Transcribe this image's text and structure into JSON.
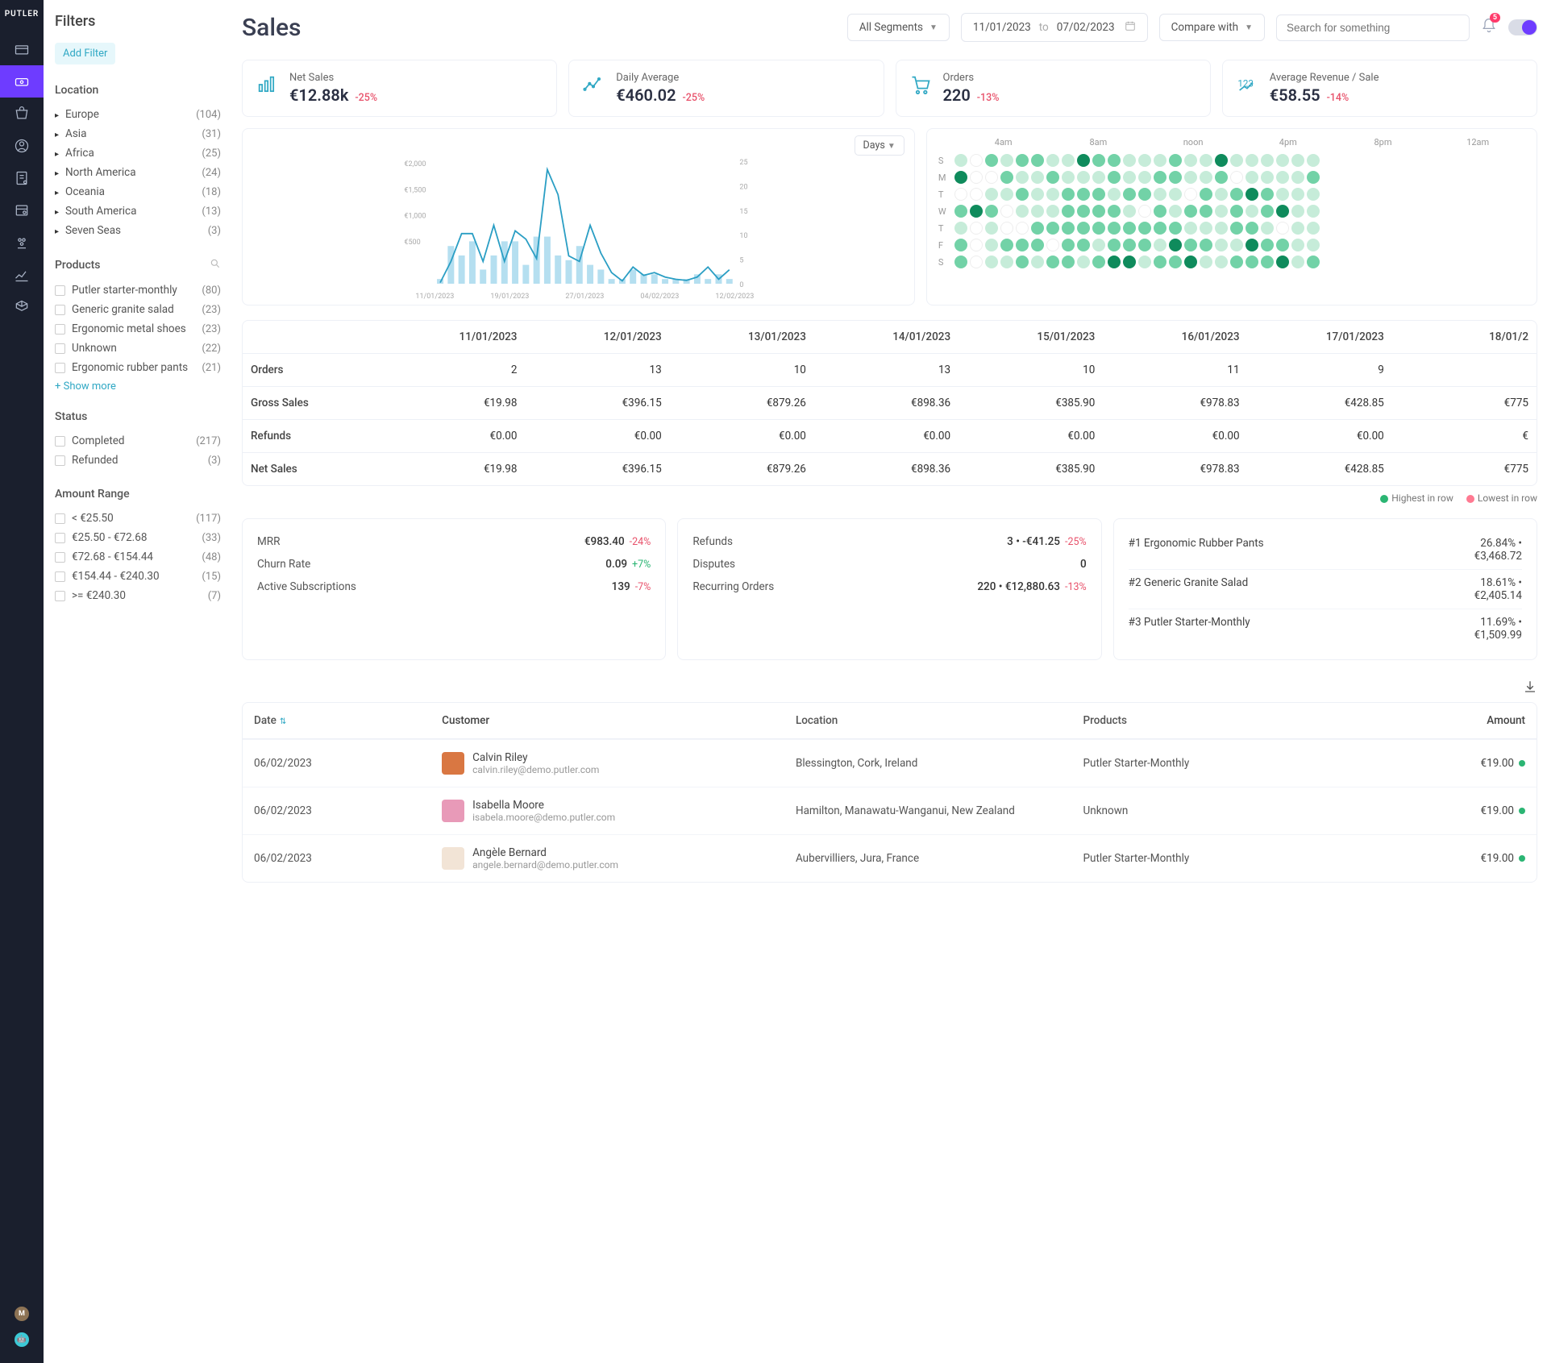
{
  "brand": "PUTLER",
  "pageTitle": "Sales",
  "header": {
    "segments": "All Segments",
    "dateFrom": "11/01/2023",
    "dateTo": "07/02/2023",
    "to": "to",
    "compare": "Compare with",
    "searchPlaceholder": "Search for something",
    "notifCount": "5"
  },
  "filtersHead": "Filters",
  "addFilter": "Add Filter",
  "filterGroups": {
    "location": {
      "title": "Location",
      "items": [
        {
          "label": "Europe",
          "count": "(104)"
        },
        {
          "label": "Asia",
          "count": "(31)"
        },
        {
          "label": "Africa",
          "count": "(25)"
        },
        {
          "label": "North America",
          "count": "(24)"
        },
        {
          "label": "Oceania",
          "count": "(18)"
        },
        {
          "label": "South America",
          "count": "(13)"
        },
        {
          "label": "Seven Seas",
          "count": "(3)"
        }
      ]
    },
    "products": {
      "title": "Products",
      "items": [
        {
          "label": "Putler starter-monthly",
          "count": "(80)"
        },
        {
          "label": "Generic granite salad",
          "count": "(23)"
        },
        {
          "label": "Ergonomic metal shoes",
          "count": "(23)"
        },
        {
          "label": "Unknown",
          "count": "(22)"
        },
        {
          "label": "Ergonomic rubber pants",
          "count": "(21)"
        }
      ],
      "showMore": "+ Show more"
    },
    "status": {
      "title": "Status",
      "items": [
        {
          "label": "Completed",
          "count": "(217)"
        },
        {
          "label": "Refunded",
          "count": "(3)"
        }
      ]
    },
    "amount": {
      "title": "Amount Range",
      "items": [
        {
          "label": "< €25.50",
          "count": "(117)"
        },
        {
          "label": "€25.50 - €72.68",
          "count": "(33)"
        },
        {
          "label": "€72.68 - €154.44",
          "count": "(48)"
        },
        {
          "label": "€154.44 - €240.30",
          "count": "(15)"
        },
        {
          "label": ">= €240.30",
          "count": "(7)"
        }
      ]
    }
  },
  "kpis": [
    {
      "label": "Net Sales",
      "value": "€12.88k",
      "delta": "-25%"
    },
    {
      "label": "Daily Average",
      "value": "€460.02",
      "delta": "-25%"
    },
    {
      "label": "Orders",
      "value": "220",
      "delta": "-13%"
    },
    {
      "label": "Average Revenue / Sale",
      "value": "€58.55",
      "delta": "-14%"
    }
  ],
  "chart_data": {
    "type": "line+bar",
    "daysLabel": "Days",
    "ylabelsLeft": [
      "€2,000",
      "€1,500",
      "€1,000",
      "€500"
    ],
    "ylabelsRight": [
      "25",
      "20",
      "15",
      "10",
      "5",
      "0"
    ],
    "xlabels": [
      "11/01/2023",
      "19/01/2023",
      "27/01/2023",
      "04/02/2023",
      "12/02/2023"
    ],
    "bars": [
      1,
      8,
      6,
      9,
      3,
      6,
      9,
      9,
      4,
      10,
      10,
      6,
      5,
      8,
      4,
      3,
      1,
      1,
      3,
      2,
      2,
      1,
      1,
      1,
      2,
      1,
      2,
      1
    ],
    "line": [
      20,
      400,
      900,
      900,
      400,
      1050,
      400,
      950,
      800,
      450,
      2050,
      1600,
      500,
      400,
      1050,
      550,
      200,
      50,
      300,
      150,
      200,
      120,
      80,
      60,
      120,
      300,
      80,
      250
    ],
    "leftMax": 2200,
    "rightMax": 26
  },
  "heatmap": {
    "head": [
      "4am",
      "8am",
      "noon",
      "4pm",
      "8pm",
      "12am"
    ],
    "days": [
      "S",
      "M",
      "T",
      "W",
      "T",
      "F",
      "S"
    ],
    "grid": [
      [
        1,
        0,
        2,
        1,
        2,
        2,
        1,
        1,
        3,
        2,
        2,
        1,
        1,
        1,
        2,
        1,
        1,
        3,
        1,
        1,
        1,
        1,
        1,
        1
      ],
      [
        3,
        0,
        0,
        2,
        1,
        1,
        2,
        1,
        1,
        1,
        2,
        1,
        1,
        2,
        2,
        1,
        1,
        2,
        0,
        1,
        1,
        1,
        1,
        2
      ],
      [
        0,
        0,
        1,
        1,
        2,
        1,
        1,
        2,
        2,
        2,
        1,
        2,
        2,
        1,
        1,
        0,
        2,
        1,
        2,
        3,
        2,
        1,
        1,
        1
      ],
      [
        2,
        3,
        2,
        0,
        1,
        1,
        1,
        2,
        2,
        2,
        2,
        1,
        0,
        2,
        1,
        2,
        2,
        1,
        2,
        1,
        2,
        3,
        1,
        1
      ],
      [
        1,
        0,
        1,
        0,
        0,
        2,
        2,
        2,
        2,
        2,
        2,
        2,
        2,
        2,
        2,
        1,
        1,
        1,
        2,
        2,
        1,
        0,
        1,
        1
      ],
      [
        2,
        0,
        1,
        2,
        2,
        2,
        0,
        2,
        2,
        1,
        2,
        2,
        2,
        1,
        3,
        2,
        2,
        1,
        1,
        3,
        2,
        2,
        1,
        1
      ],
      [
        2,
        0,
        1,
        1,
        2,
        1,
        2,
        2,
        1,
        2,
        3,
        3,
        1,
        2,
        2,
        3,
        1,
        1,
        2,
        2,
        2,
        3,
        1,
        2
      ]
    ],
    "colors": [
      "#ffffff",
      "#c6ecd9",
      "#72d2a7",
      "#0f8b5c"
    ]
  },
  "dataTable": {
    "cols": [
      "",
      "11/01/2023",
      "12/01/2023",
      "13/01/2023",
      "14/01/2023",
      "15/01/2023",
      "16/01/2023",
      "17/01/2023",
      "18/01/2"
    ],
    "rows": [
      {
        "label": "Orders",
        "vals": [
          "2",
          "13",
          "10",
          "13",
          "10",
          "11",
          "9",
          ""
        ]
      },
      {
        "label": "Gross Sales",
        "vals": [
          "€19.98",
          "€396.15",
          "€879.26",
          "€898.36",
          "€385.90",
          "€978.83",
          "€428.85",
          "€775"
        ]
      },
      {
        "label": "Refunds",
        "vals": [
          "€0.00",
          "€0.00",
          "€0.00",
          "€0.00",
          "€0.00",
          "€0.00",
          "€0.00",
          "€"
        ]
      },
      {
        "label": "Net Sales",
        "vals": [
          "€19.98",
          "€396.15",
          "€879.26",
          "€898.36",
          "€385.90",
          "€978.83",
          "€428.85",
          "€775"
        ]
      }
    ],
    "legendHigh": "Highest in row",
    "legendLow": "Lowest in row"
  },
  "mini1": [
    {
      "label": "MRR",
      "value": "€983.40",
      "delta": "-24%",
      "dir": "down"
    },
    {
      "label": "Churn Rate",
      "value": "0.09",
      "delta": "+7%",
      "dir": "up"
    },
    {
      "label": "Active Subscriptions",
      "value": "139",
      "delta": "-7%",
      "dir": "down"
    }
  ],
  "mini2": [
    {
      "label": "Refunds",
      "value": "3 • -€41.25",
      "delta": "-25%",
      "dir": "down"
    },
    {
      "label": "Disputes",
      "value": "0",
      "delta": "",
      "dir": ""
    },
    {
      "label": "Recurring Orders",
      "value": "220 • €12,880.63",
      "delta": "-13%",
      "dir": "down"
    }
  ],
  "mini3": [
    {
      "name": "#1 Ergonomic Rubber Pants",
      "pct": "26.84% •",
      "amt": "€3,468.72"
    },
    {
      "name": "#2 Generic Granite Salad",
      "pct": "18.61% •",
      "amt": "€2,405.14"
    },
    {
      "name": "#3 Putler Starter-Monthly",
      "pct": "11.69% •",
      "amt": "€1,509.99"
    }
  ],
  "ordersHead": {
    "date": "Date",
    "customer": "Customer",
    "location": "Location",
    "products": "Products",
    "amount": "Amount"
  },
  "orders": [
    {
      "date": "06/02/2023",
      "name": "Calvin Riley",
      "email": "calvin.riley@demo.putler.com",
      "location": "Blessington, Cork, Ireland",
      "product": "Putler Starter-Monthly",
      "amount": "€19.00",
      "avatar": "#d97742"
    },
    {
      "date": "06/02/2023",
      "name": "Isabella Moore",
      "email": "isabela.moore@demo.putler.com",
      "location": "Hamilton, Manawatu-Wanganui, New Zealand",
      "product": "Unknown",
      "amount": "€19.00",
      "avatar": "#e89ab8"
    },
    {
      "date": "06/02/2023",
      "name": "Angèle Bernard",
      "email": "angele.bernard@demo.putler.com",
      "location": "Aubervilliers, Jura, France",
      "product": "Putler Starter-Monthly",
      "amount": "€19.00",
      "avatar": "#f2e4d6"
    }
  ]
}
